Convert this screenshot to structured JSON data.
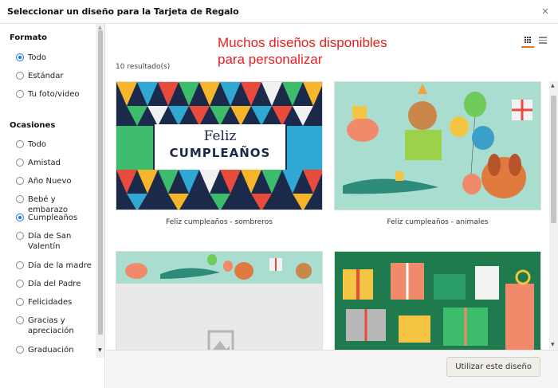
{
  "header": {
    "title": "Seleccionar un diseño para la Tarjeta de Regalo"
  },
  "annotation": {
    "line1": "Muchos diseños disponibles",
    "line2": "para personalizar"
  },
  "sidebar": {
    "format_title": "Formato",
    "format_options": [
      {
        "label": "Todo",
        "checked": true
      },
      {
        "label": "Estándar",
        "checked": false
      },
      {
        "label": "Tu foto/video",
        "checked": false
      }
    ],
    "occasions_title": "Ocasiones",
    "occasion_options": [
      {
        "label": "Todo",
        "checked": false
      },
      {
        "label": "Amistad",
        "checked": false
      },
      {
        "label": "Año Nuevo",
        "checked": false
      },
      {
        "label": "Bebé y embarazo",
        "checked": false
      },
      {
        "label": "Cumpleaños",
        "checked": true
      },
      {
        "label": "Día de San Valentín",
        "checked": false
      },
      {
        "label": "Día de la madre",
        "checked": false
      },
      {
        "label": "Día del Padre",
        "checked": false
      },
      {
        "label": "Felicidades",
        "checked": false
      },
      {
        "label": "Gracias y apreciación",
        "checked": false
      },
      {
        "label": "Graduación",
        "checked": false
      }
    ]
  },
  "main": {
    "results": "10 resultado(s)",
    "cards": [
      {
        "caption": "Feliz cumpleaños - sombreros",
        "title_small": "Feliz",
        "title_big": "CUMPLEAÑOS"
      },
      {
        "caption": "Feliz cumpleaños - animales"
      },
      {
        "caption": ""
      },
      {
        "caption": ""
      }
    ]
  },
  "footer": {
    "use_button": "Utilizar este diseño"
  },
  "colors": {
    "accent": "#e47911",
    "radio": "#1a73e8",
    "annotation": "#e8201c"
  }
}
